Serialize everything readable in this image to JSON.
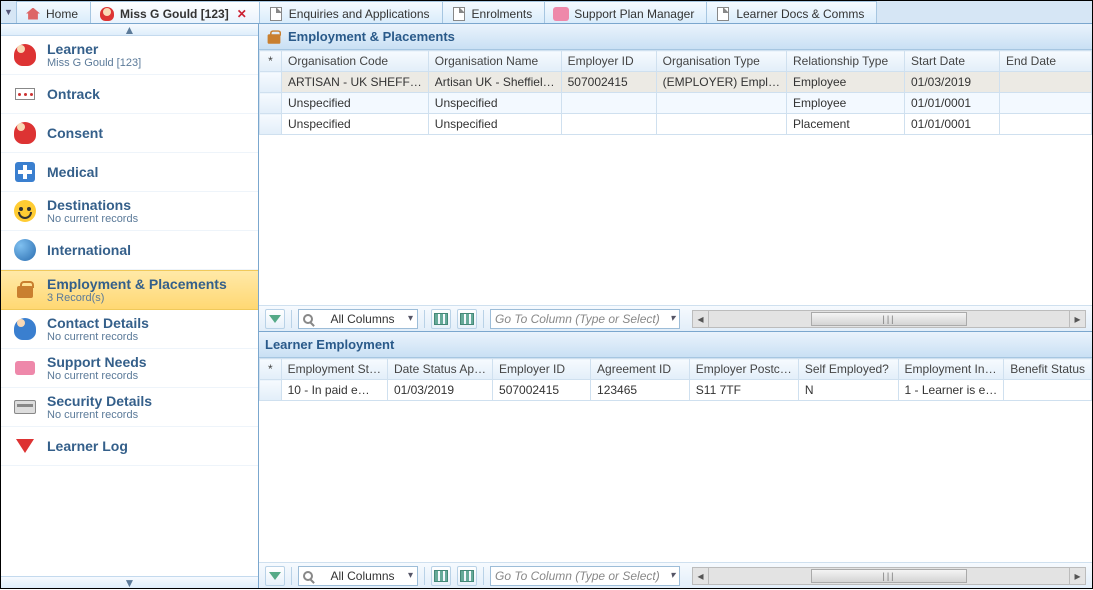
{
  "tabs": [
    {
      "label": "Home"
    },
    {
      "label": "Miss G Gould [123]",
      "active": true,
      "closable": true
    },
    {
      "label": "Enquiries and Applications"
    },
    {
      "label": "Enrolments"
    },
    {
      "label": "Support Plan Manager"
    },
    {
      "label": "Learner Docs & Comms"
    }
  ],
  "sidebar": [
    {
      "title": "Learner",
      "sub": "Miss G Gould [123]",
      "icon": "person"
    },
    {
      "title": "Ontrack",
      "icon": "dots"
    },
    {
      "title": "Consent",
      "icon": "person-check"
    },
    {
      "title": "Medical",
      "icon": "medical"
    },
    {
      "title": "Destinations",
      "sub": "No current records",
      "icon": "face"
    },
    {
      "title": "International",
      "icon": "globe"
    },
    {
      "title": "Employment & Placements",
      "sub": "3 Record(s)",
      "icon": "bag",
      "selected": true
    },
    {
      "title": "Contact Details",
      "sub": "No current records",
      "icon": "person"
    },
    {
      "title": "Support Needs",
      "sub": "No current records",
      "icon": "support"
    },
    {
      "title": "Security Details",
      "sub": "No current records",
      "icon": "card"
    },
    {
      "title": "Learner Log",
      "icon": "downarrow"
    }
  ],
  "panels": {
    "ep": {
      "title": "Employment & Placements",
      "columns": [
        "*",
        "Organisation Code",
        "Organisation Name",
        "Employer ID",
        "Organisation Type",
        "Relationship Type",
        "Start Date",
        "End Date"
      ],
      "rows": [
        [
          "",
          "ARTISAN - UK SHEFF…",
          "Artisan UK - Sheffiel…",
          "507002415",
          "(EMPLOYER) Empl…",
          "Employee",
          "01/03/2019",
          ""
        ],
        [
          "",
          "Unspecified",
          "Unspecified",
          "",
          "",
          "Employee",
          "01/01/0001",
          ""
        ],
        [
          "",
          "Unspecified",
          "Unspecified",
          "",
          "",
          "Placement",
          "01/01/0001",
          ""
        ]
      ]
    },
    "le": {
      "title": "Learner Employment",
      "columns": [
        "*",
        "Employment St…",
        "Date Status Ap…",
        "Employer ID",
        "Agreement ID",
        "Employer Postc…",
        "Self Employed?",
        "Employment In…",
        "Benefit Status"
      ],
      "rows": [
        [
          "",
          "10 - In paid e…",
          "01/03/2019",
          "507002415",
          "123465",
          "S11 7TF",
          "N",
          "1 - Learner is e…",
          ""
        ]
      ]
    }
  },
  "toolbar": {
    "filter_combo": "All Columns",
    "goto_placeholder": "Go To Column (Type or Select)"
  }
}
